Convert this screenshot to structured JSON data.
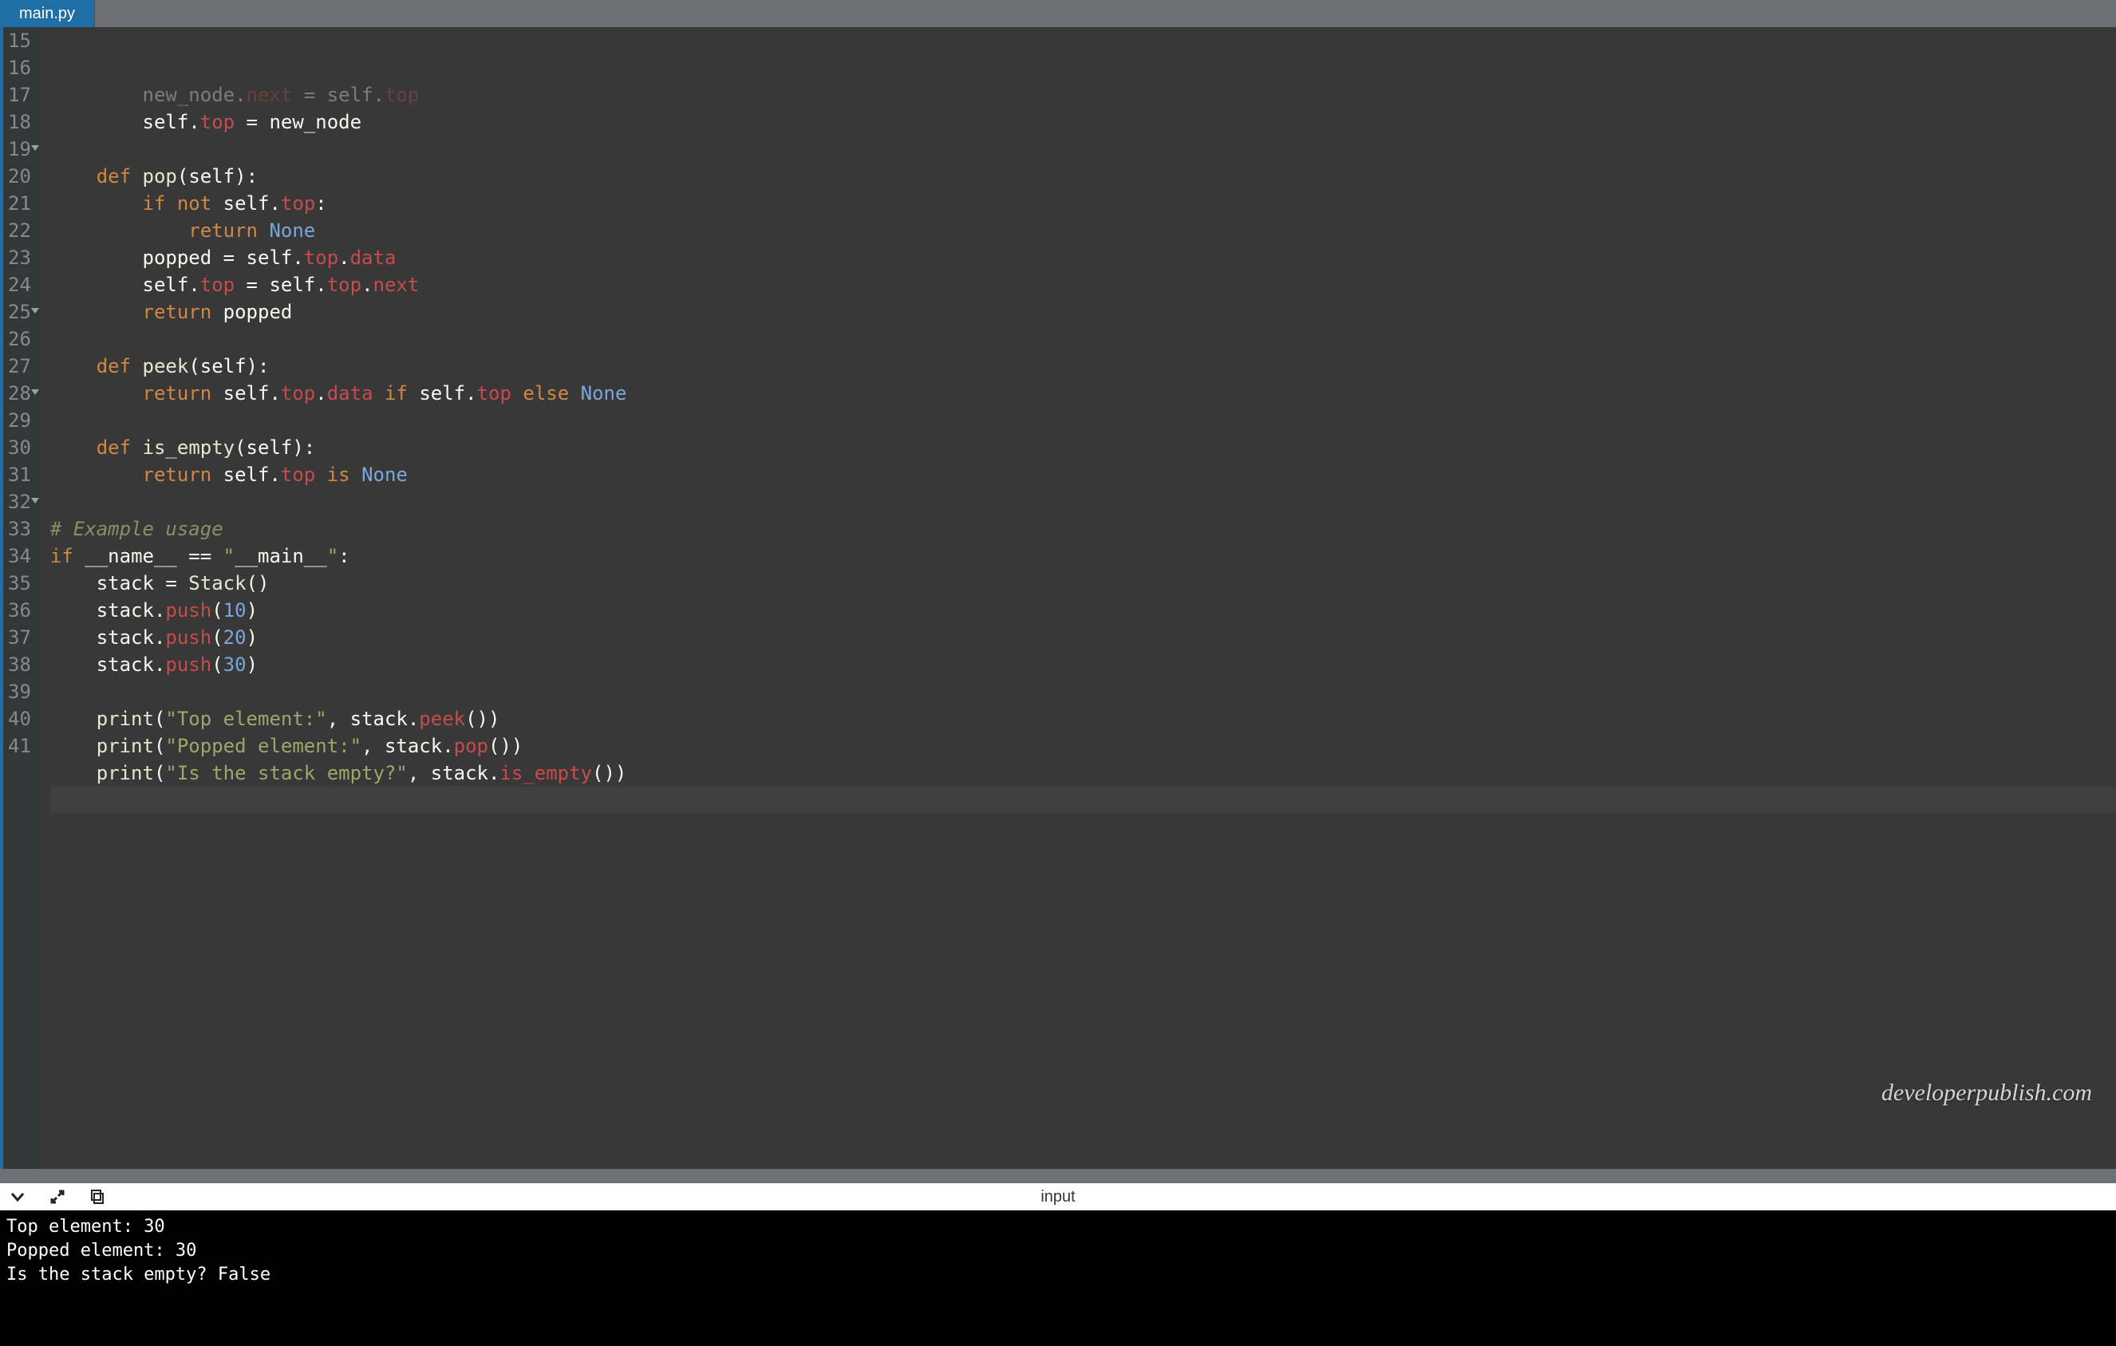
{
  "tabs": {
    "active_label": "main.py"
  },
  "gutter_start": 15,
  "gutter_end": 41,
  "fold_lines": [
    19,
    25,
    28,
    32
  ],
  "active_line": 41,
  "code": {
    "15": [
      [
        "def",
        "new_node"
      ],
      [
        "op",
        "."
      ],
      [
        "attr",
        "next"
      ],
      [
        "def",
        " "
      ],
      [
        "op",
        "="
      ],
      [
        "def",
        " self"
      ],
      [
        "op",
        "."
      ],
      [
        "attr",
        "top"
      ]
    ],
    "l15_indent": 16,
    "l16": "        self.top = new_node",
    "l17": "",
    "l18": "    def pop(self):",
    "l19": "        if not self.top:",
    "l20": "            return None",
    "l21": "        popped = self.top.data",
    "l22": "        self.top = self.top.next",
    "l23": "        return popped",
    "l24": "",
    "l25": "    def peek(self):",
    "l26": "        return self.top.data if self.top else None",
    "l27": "",
    "l28": "    def is_empty(self):",
    "l29": "        return self.top is None",
    "l30": "",
    "l31": "# Example usage",
    "l32": "if __name__ == \"__main__\":",
    "l33": "    stack = Stack()",
    "l34": "    stack.push(10)",
    "l35": "    stack.push(20)",
    "l36": "    stack.push(30)",
    "l37": "",
    "l38": "    print(\"Top element:\", stack.peek())",
    "l39": "    print(\"Popped element:\", stack.pop())",
    "l40": "    print(\"Is the stack empty?\", stack.is_empty())",
    "l41": ""
  },
  "panel": {
    "title": "input"
  },
  "console_lines": [
    "Top element: 30",
    "Popped element: 30",
    "Is the stack empty? False"
  ],
  "watermark": "developerpublish.com"
}
